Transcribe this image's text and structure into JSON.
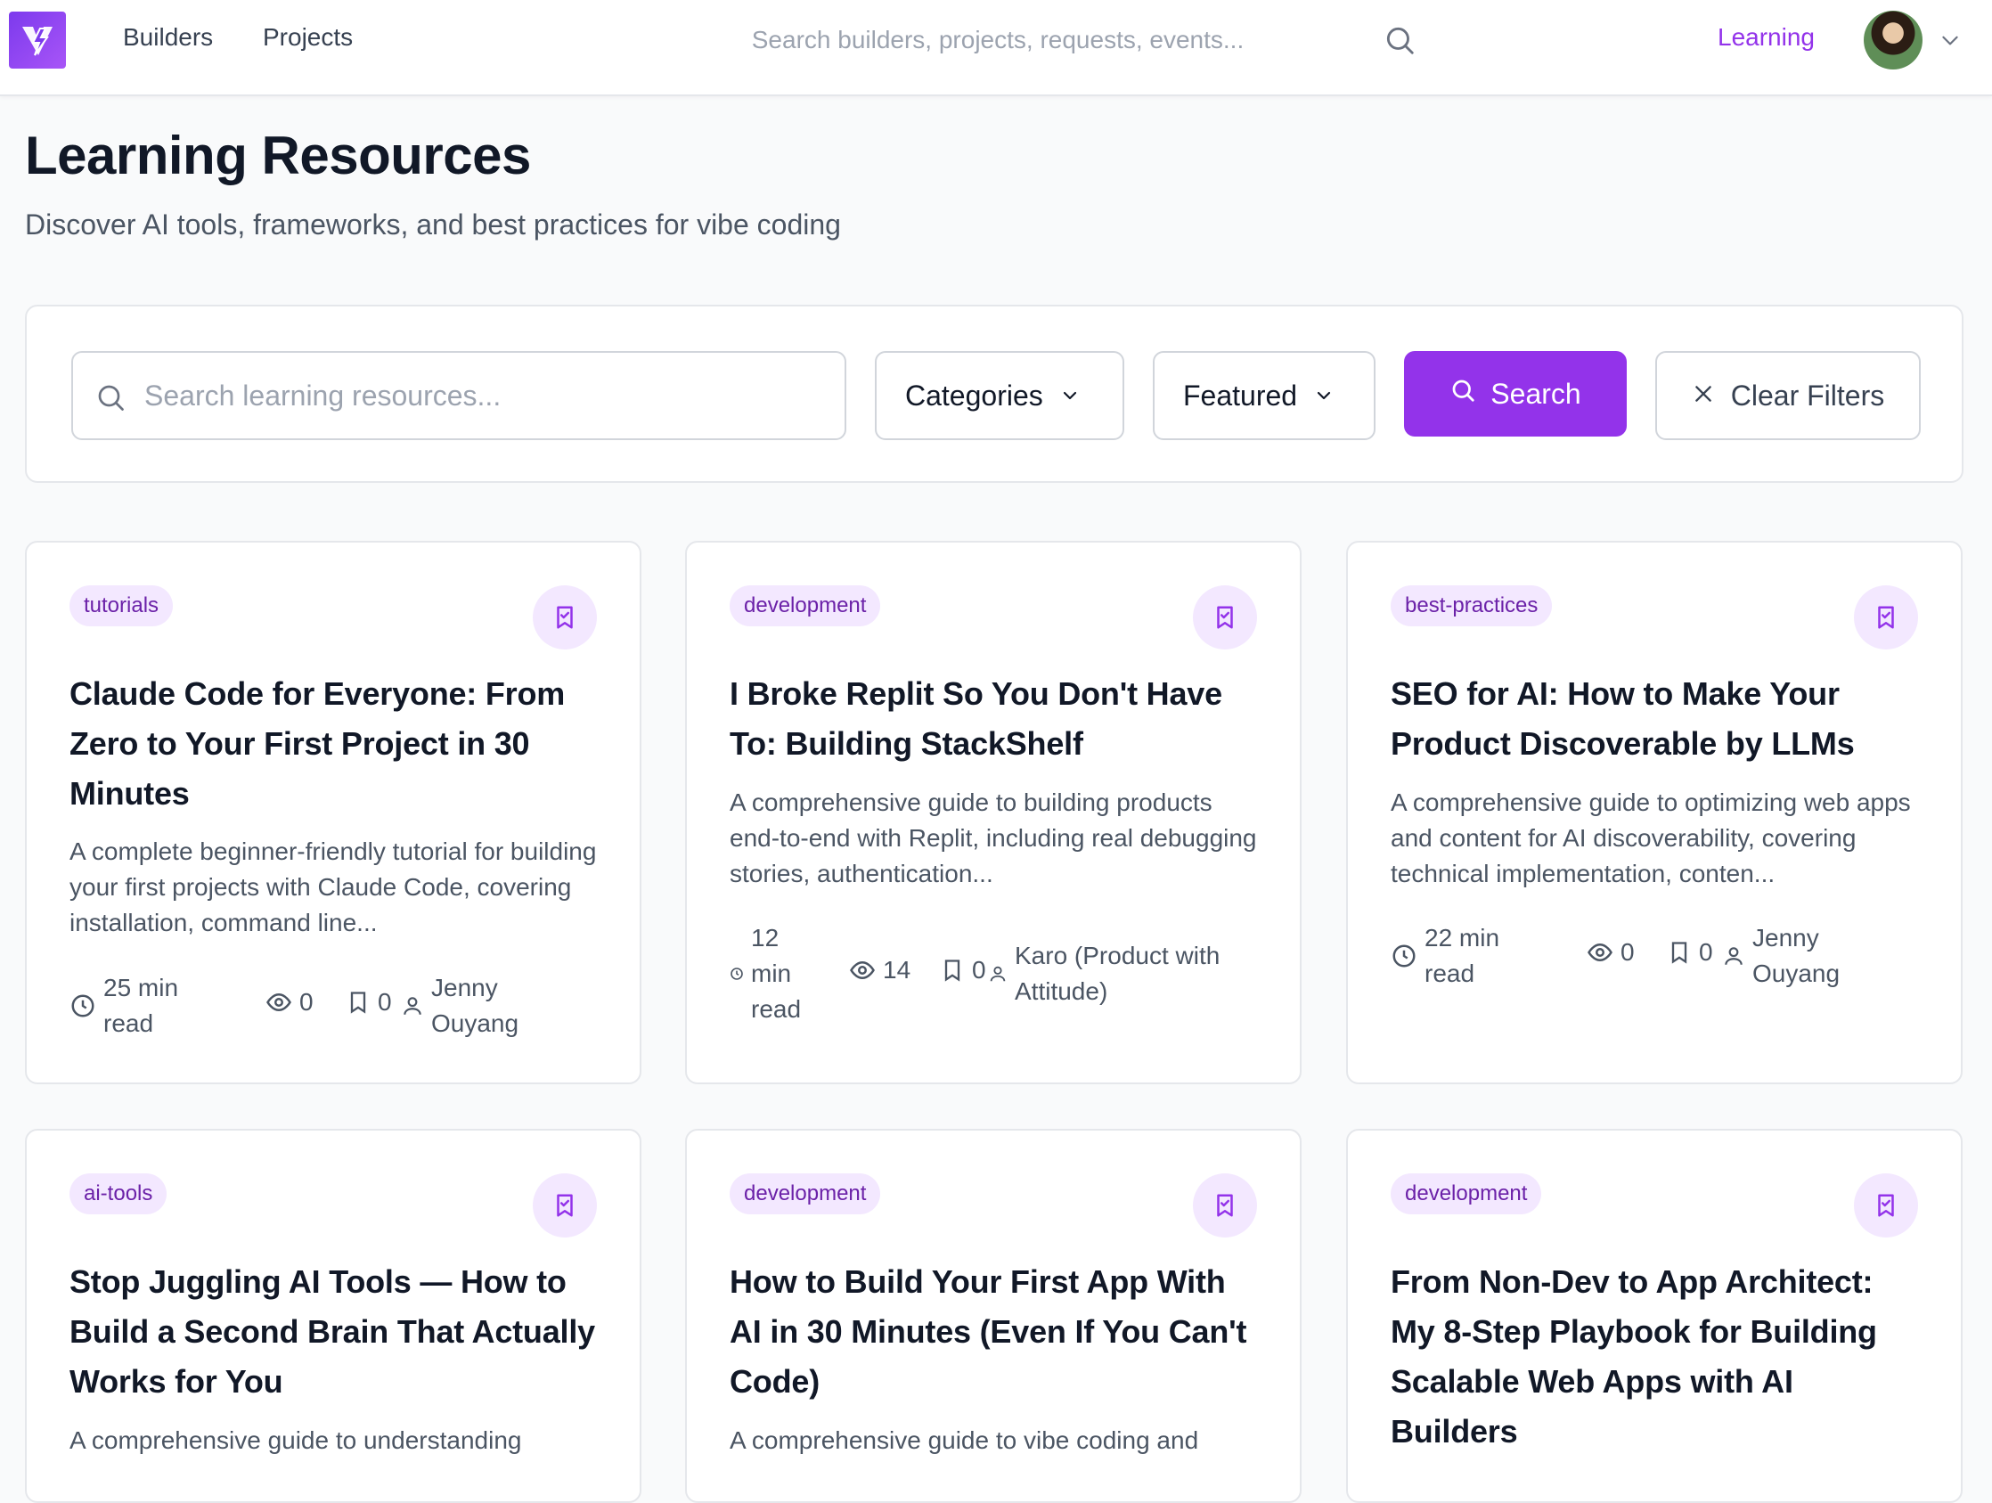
{
  "nav": {
    "builders": "Builders",
    "projects": "Projects",
    "search_placeholder": "Search builders, projects, requests, events...",
    "learning": "Learning",
    "accent": "#9333ea"
  },
  "header": {
    "title": "Learning Resources",
    "subtitle": "Discover AI tools, frameworks, and best practices for vibe coding"
  },
  "filters": {
    "search_placeholder": "Search learning resources...",
    "categories": "Categories",
    "featured": "Featured",
    "search_button": "Search",
    "clear_button": "Clear Filters"
  },
  "cards": [
    {
      "tag": "tutorials",
      "title": "Claude Code for Everyone: From Zero to Your First Project in 30 Minutes",
      "desc": "A complete beginner-friendly tutorial for building your first projects with Claude Code, covering installation, command line...",
      "read_num": "25 min",
      "read_unit": "read",
      "views": "0",
      "saves": "0",
      "author_l1": "Jenny",
      "author_l2": "Ouyang"
    },
    {
      "tag": "development",
      "title": "I Broke Replit So You Don't Have To: Building StackShelf",
      "desc": "A comprehensive guide to building products end-to-end with Replit, including real debugging stories, authentication...",
      "read_num": "12",
      "read_mid": "min",
      "read_unit": "read",
      "views": "14",
      "saves": "0",
      "author_l1": "Karo (Product with",
      "author_l2": "Attitude)"
    },
    {
      "tag": "best-practices",
      "title": "SEO for AI: How to Make Your Product Discoverable by LLMs",
      "desc": "A comprehensive guide to optimizing web apps and content for AI discoverability, covering technical implementation, conten...",
      "read_num": "22 min",
      "read_unit": "read",
      "views": "0",
      "saves": "0",
      "author_l1": "Jenny",
      "author_l2": "Ouyang"
    },
    {
      "tag": "ai-tools",
      "title": "Stop Juggling AI Tools — How to Build a Second Brain That Actually Works for You",
      "desc": "A comprehensive guide to understanding"
    },
    {
      "tag": "development",
      "title": "How to Build Your First App With AI in 30 Minutes (Even If You Can't Code)",
      "desc": "A comprehensive guide to vibe coding and"
    },
    {
      "tag": "development",
      "title": "From Non-Dev to App Architect: My 8-Step Playbook for Building Scalable Web Apps with AI Builders",
      "desc": ""
    }
  ]
}
